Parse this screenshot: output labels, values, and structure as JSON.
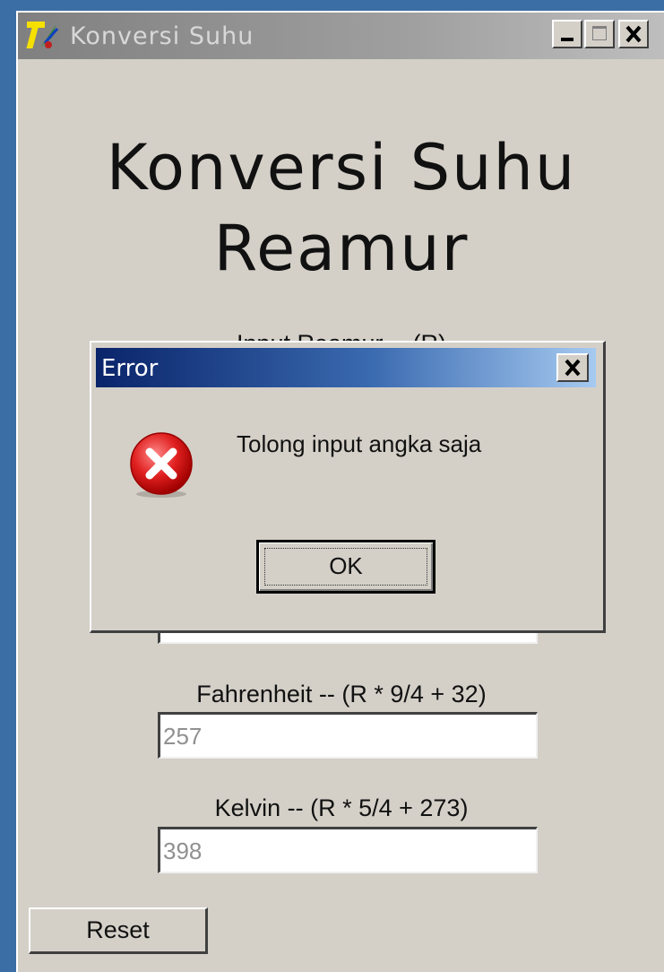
{
  "window": {
    "title": "Konversi Suhu",
    "icon": "tk-feather-icon"
  },
  "page": {
    "title_line1": "Konversi Suhu",
    "title_line2": "Reamur"
  },
  "fields": {
    "reamur_label": "Input Reamur -- (R)",
    "fahrenheit_label": "Fahrenheit -- (R * 9/4 + 32)",
    "fahrenheit_value": "257",
    "kelvin_label": "Kelvin -- (R * 5/4 + 273)",
    "kelvin_value": "398"
  },
  "buttons": {
    "reset_label": "Reset"
  },
  "dialog": {
    "title": "Error",
    "message": "Tolong input angka saja",
    "ok_label": "OK",
    "icon": "error-icon"
  },
  "colors": {
    "desktop": "#3a6ea5",
    "window_face": "#d4d0c8",
    "dialog_title_start": "#0a246a",
    "dialog_title_end": "#a6caf0",
    "error_red": "#e02020"
  }
}
